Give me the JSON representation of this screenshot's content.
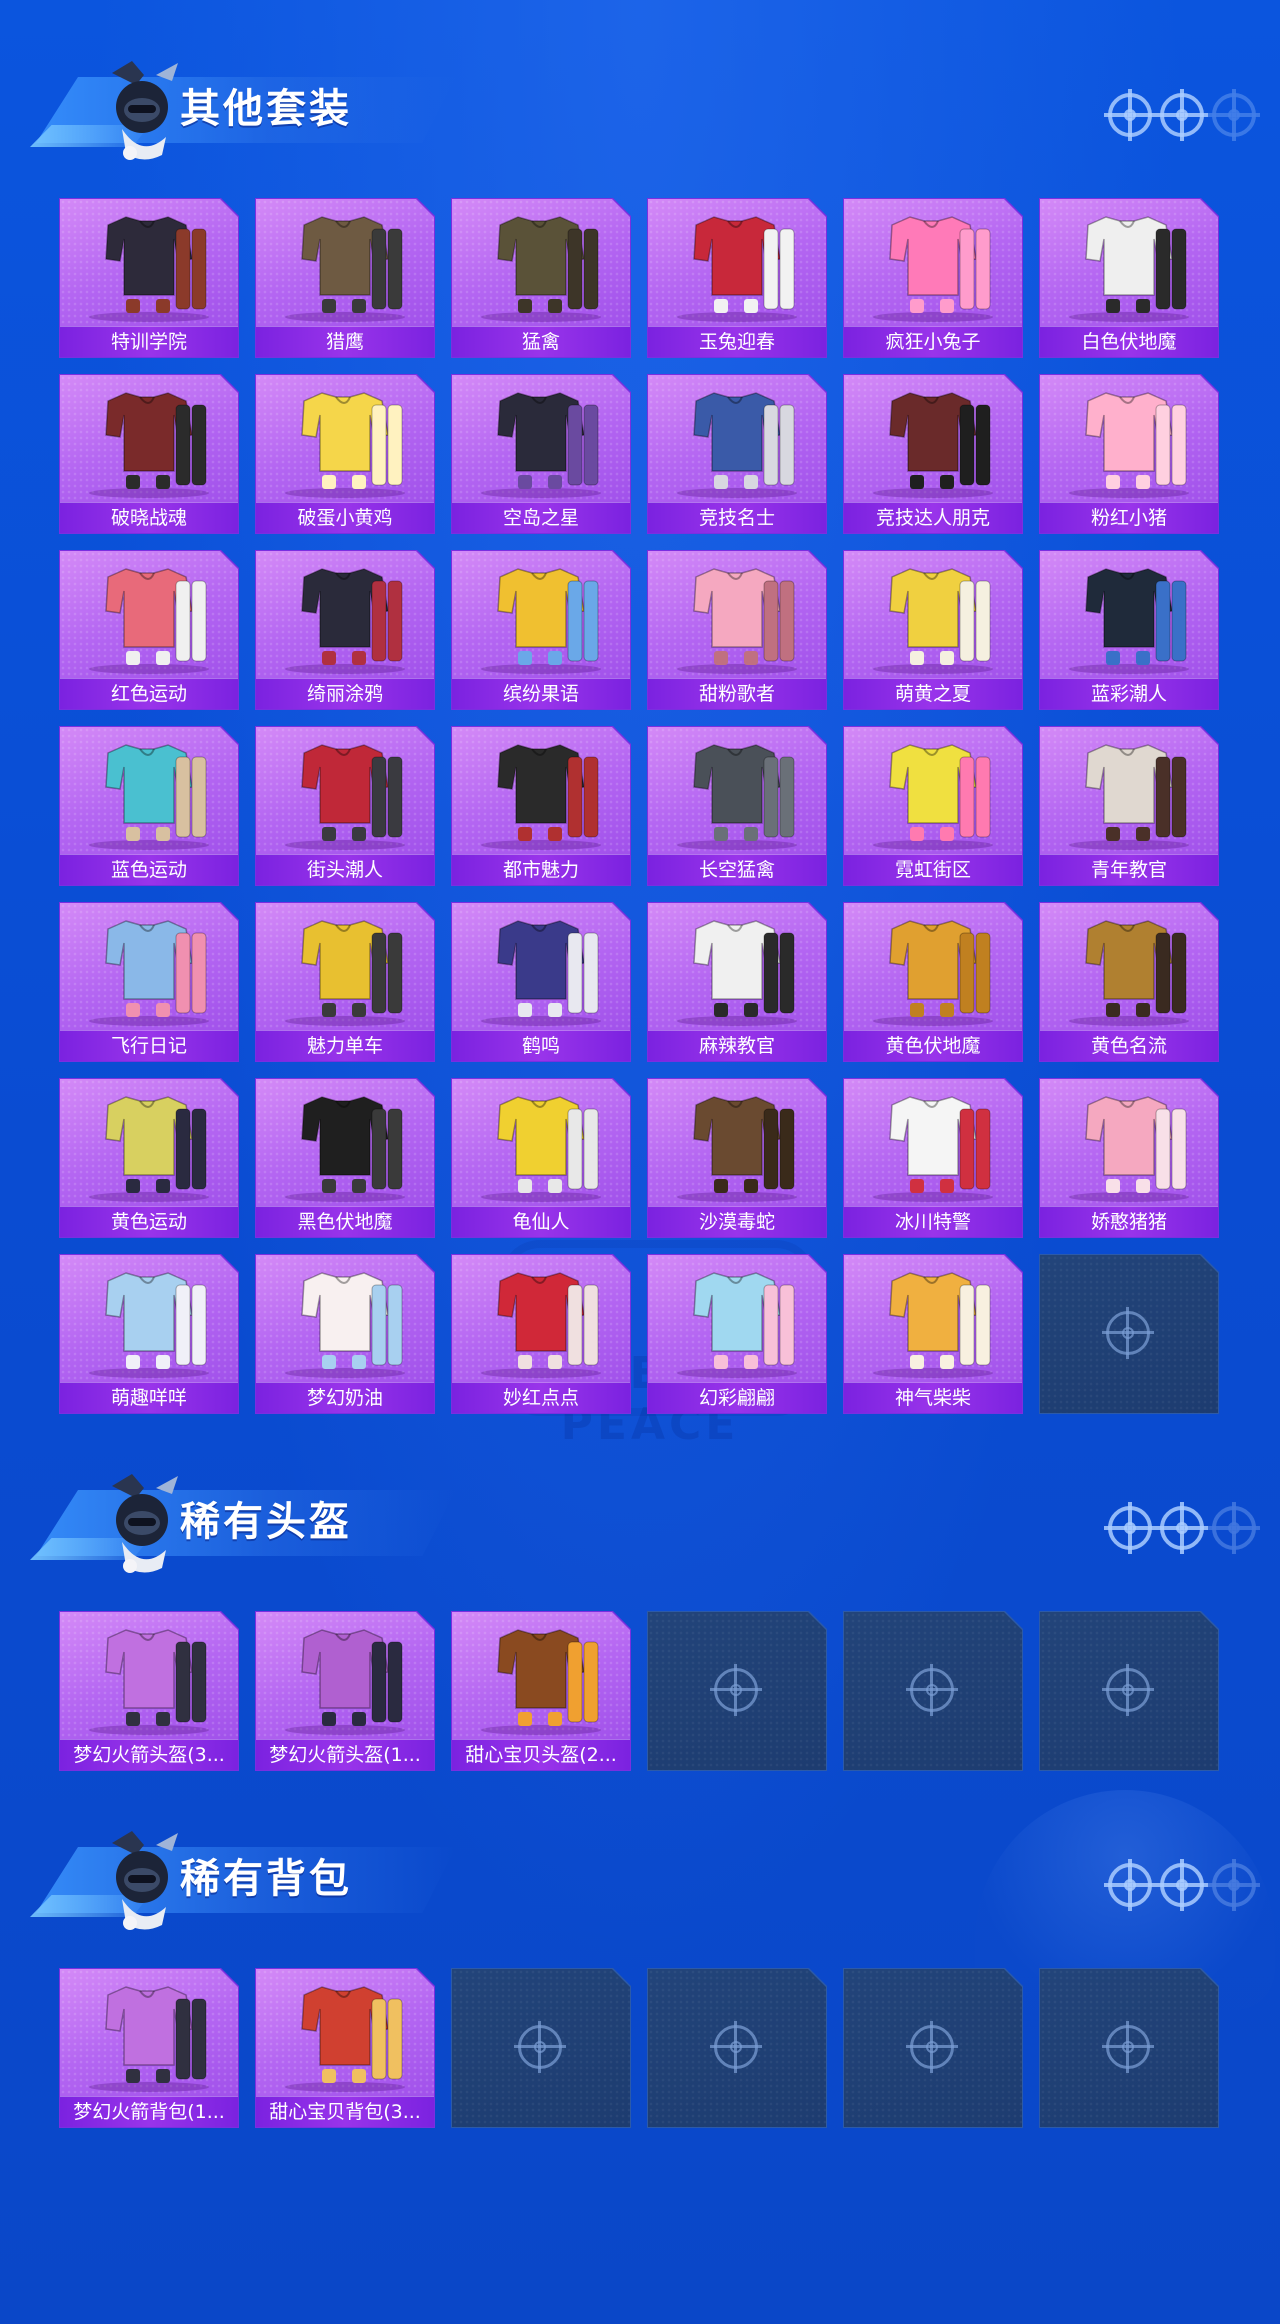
{
  "sections": [
    {
      "title": "其他套装",
      "items": [
        {
          "name": "特训学院",
          "colors": [
            "#2d2a3a",
            "#8b3a2a"
          ]
        },
        {
          "name": "猎鹰",
          "colors": [
            "#6e5a42",
            "#3a3a3a"
          ]
        },
        {
          "name": "猛禽",
          "colors": [
            "#5a5238",
            "#3d3528"
          ]
        },
        {
          "name": "玉兔迎春",
          "colors": [
            "#c8283a",
            "#f2f2f2"
          ]
        },
        {
          "name": "疯狂小兔子",
          "colors": [
            "#ff7ab8",
            "#ff9ccc"
          ]
        },
        {
          "name": "白色伏地魔",
          "colors": [
            "#efefef",
            "#2a2a2a"
          ]
        },
        {
          "name": "破晓战魂",
          "colors": [
            "#7a2a2a",
            "#2b2b2b"
          ]
        },
        {
          "name": "破蛋小黄鸡",
          "colors": [
            "#f5d64a",
            "#fff2c0"
          ]
        },
        {
          "name": "空岛之星",
          "colors": [
            "#2a2a3a",
            "#6a4aa0"
          ]
        },
        {
          "name": "竞技名士",
          "colors": [
            "#3a5aa8",
            "#d8d8e0"
          ]
        },
        {
          "name": "竞技达人朋克",
          "colors": [
            "#6a2a2a",
            "#1f1f1f"
          ]
        },
        {
          "name": "粉红小猪",
          "colors": [
            "#ffb0cc",
            "#ffd0e0"
          ]
        },
        {
          "name": "红色运动",
          "colors": [
            "#e86a7a",
            "#f0f0f0"
          ]
        },
        {
          "name": "绮丽涂鸦",
          "colors": [
            "#2a2a3a",
            "#b03040"
          ]
        },
        {
          "name": "缤纷果语",
          "colors": [
            "#f0c030",
            "#6aa8e8"
          ]
        },
        {
          "name": "甜粉歌者",
          "colors": [
            "#f5a8c0",
            "#c07080"
          ]
        },
        {
          "name": "萌黄之夏",
          "colors": [
            "#f0d040",
            "#f5f0e0"
          ]
        },
        {
          "name": "蓝彩潮人",
          "colors": [
            "#1f2a3a",
            "#3a70c8"
          ]
        },
        {
          "name": "蓝色运动",
          "colors": [
            "#4ac0d0",
            "#d8c0a0"
          ]
        },
        {
          "name": "街头潮人",
          "colors": [
            "#c02838",
            "#3a3a40"
          ]
        },
        {
          "name": "都市魅力",
          "colors": [
            "#2a2a2a",
            "#b03030"
          ]
        },
        {
          "name": "长空猛禽",
          "colors": [
            "#4a5058",
            "#6a7078"
          ]
        },
        {
          "name": "霓虹街区",
          "colors": [
            "#f0e040",
            "#ff7ab0"
          ]
        },
        {
          "name": "青年教官",
          "colors": [
            "#e0d8d0",
            "#4a3028"
          ]
        },
        {
          "name": "飞行日记",
          "colors": [
            "#8ab8e8",
            "#f090b0"
          ]
        },
        {
          "name": "魅力单车",
          "colors": [
            "#e8c030",
            "#3a3a3a"
          ]
        },
        {
          "name": "鹤鸣",
          "colors": [
            "#3a3a8a",
            "#e8e8f0"
          ]
        },
        {
          "name": "麻辣教官",
          "colors": [
            "#f0f0f0",
            "#2a2a2a"
          ]
        },
        {
          "name": "黄色伏地魔",
          "colors": [
            "#e0a030",
            "#c08020"
          ]
        },
        {
          "name": "黄色名流",
          "colors": [
            "#b08030",
            "#3a2a20"
          ]
        },
        {
          "name": "黄色运动",
          "colors": [
            "#d8d060",
            "#2a2a40"
          ]
        },
        {
          "name": "黑色伏地魔",
          "colors": [
            "#1f1f1f",
            "#3a3a3a"
          ]
        },
        {
          "name": "龟仙人",
          "colors": [
            "#f0d030",
            "#e8e8e8"
          ]
        },
        {
          "name": "沙漠毒蛇",
          "colors": [
            "#6a4a30",
            "#3a2a1a"
          ]
        },
        {
          "name": "冰川特警",
          "colors": [
            "#f5f5f5",
            "#d03040"
          ]
        },
        {
          "name": "娇憨猪猪",
          "colors": [
            "#f5a8c0",
            "#f8e0e8"
          ]
        },
        {
          "name": "萌趣咩咩",
          "colors": [
            "#a8d0f0",
            "#f0f0f8"
          ]
        },
        {
          "name": "梦幻奶油",
          "colors": [
            "#f8f0f0",
            "#a8d0f0"
          ]
        },
        {
          "name": "妙红点点",
          "colors": [
            "#d02838",
            "#f0e0e0"
          ]
        },
        {
          "name": "幻彩翩翩",
          "colors": [
            "#a0d8f0",
            "#f8c0d8"
          ]
        },
        {
          "name": "神气柴柴",
          "colors": [
            "#f0b040",
            "#f8f0e0"
          ]
        }
      ],
      "empty_slots": 1
    },
    {
      "title": "稀有头盔",
      "items": [
        {
          "name": "梦幻火箭头盔(3...",
          "colors": [
            "#c070e0",
            "#303040"
          ]
        },
        {
          "name": "梦幻火箭头盔(1...",
          "colors": [
            "#b060d0",
            "#2a2a40"
          ]
        },
        {
          "name": "甜心宝贝头盔(2...",
          "colors": [
            "#8a4a20",
            "#f0a030"
          ]
        }
      ],
      "empty_slots": 3
    },
    {
      "title": "稀有背包",
      "items": [
        {
          "name": "梦幻火箭背包(1...",
          "colors": [
            "#c070e0",
            "#303040"
          ]
        },
        {
          "name": "甜心宝贝背包(3...",
          "colors": [
            "#d04030",
            "#f0c060"
          ]
        }
      ],
      "empty_slots": 4
    }
  ],
  "watermark": "GAME FOR PEACE"
}
